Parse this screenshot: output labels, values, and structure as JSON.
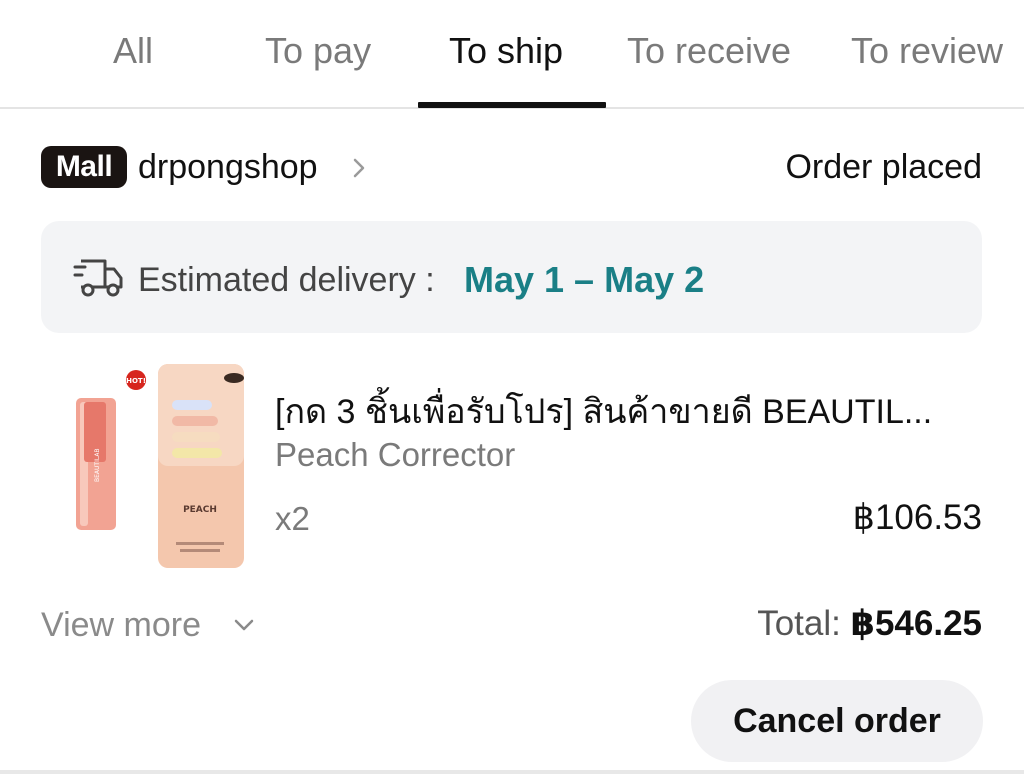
{
  "tabs": [
    {
      "label": "All",
      "active": false
    },
    {
      "label": "To pay",
      "active": false
    },
    {
      "label": "To ship",
      "active": true
    },
    {
      "label": "To receive",
      "active": false
    },
    {
      "label": "To review",
      "active": false
    }
  ],
  "shop": {
    "badge": "Mall",
    "name": "drpongshop",
    "status": "Order placed"
  },
  "delivery": {
    "icon": "delivery-truck-icon",
    "label": "Estimated delivery :",
    "dates": "May 1 – May 2",
    "date_color": "#1a7f86"
  },
  "product": {
    "image": {
      "badge": "HOT!",
      "card_text": "PEACH",
      "tube_label": "BEAUTILAB"
    },
    "title": "[กด 3 ชิ้นเพื่อรับโปร] สินค้าขายดี BEAUTIL...",
    "variant": "Peach Corrector",
    "quantity": "x2",
    "price": "฿106.53"
  },
  "summary": {
    "view_more": "View more",
    "total_label": "Total:",
    "total_value": "฿546.25"
  },
  "actions": {
    "cancel_label": "Cancel order"
  }
}
